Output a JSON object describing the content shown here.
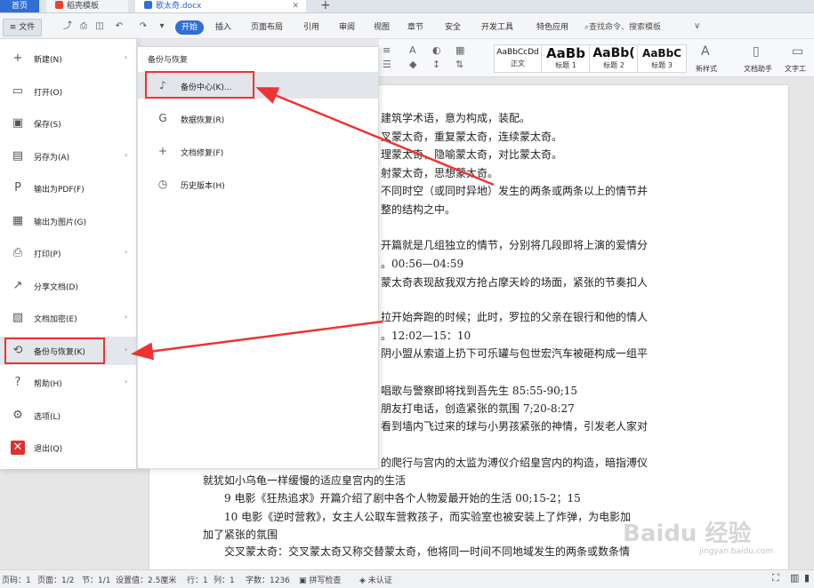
{
  "tabs": {
    "home": "首页",
    "templates": "稻壳模板",
    "doc": "歌太奇.docx",
    "add": "+"
  },
  "ribbon": {
    "file": "≡ 文件",
    "tabs": [
      "开始",
      "插入",
      "页面布局",
      "引用",
      "审阅",
      "视图",
      "章节",
      "安全",
      "开发工具",
      "特色应用"
    ],
    "search": "查找命令、搜索模板"
  },
  "styles": [
    {
      "sample": "AaBbCcDd",
      "name": "正文"
    },
    {
      "sample": "AaBb",
      "name": "标题 1"
    },
    {
      "sample": "AaBb(",
      "name": "标题 2"
    },
    {
      "sample": "AaBbC",
      "name": "标题 3"
    }
  ],
  "toolbar_right": {
    "new_style": "新样式",
    "doc_helper": "文档助手",
    "text_tools": "文字工"
  },
  "file_menu": [
    {
      "label": "新建(N)",
      "icon": "new-doc-icon",
      "glyph": "+",
      "arrow": true
    },
    {
      "label": "打开(O)",
      "icon": "folder-icon",
      "glyph": "▭",
      "arrow": false
    },
    {
      "label": "保存(S)",
      "icon": "save-icon",
      "glyph": "▣",
      "arrow": false
    },
    {
      "label": "另存为(A)",
      "icon": "save-as-icon",
      "glyph": "▤",
      "arrow": true
    },
    {
      "label": "输出为PDF(F)",
      "icon": "pdf-icon",
      "glyph": "P",
      "arrow": false
    },
    {
      "label": "输出为图片(G)",
      "icon": "image-icon",
      "glyph": "▦",
      "arrow": false
    },
    {
      "label": "打印(P)",
      "icon": "print-icon",
      "glyph": "⎙",
      "arrow": true
    },
    {
      "label": "分享文档(D)",
      "icon": "share-icon",
      "glyph": "↗",
      "arrow": false
    },
    {
      "label": "文档加密(E)",
      "icon": "lock-doc-icon",
      "glyph": "▧",
      "arrow": true
    },
    {
      "label": "备份与恢复(K)",
      "icon": "backup-icon",
      "glyph": "⟲",
      "arrow": true
    },
    {
      "label": "帮助(H)",
      "icon": "help-icon",
      "glyph": "?",
      "arrow": true
    },
    {
      "label": "选项(L)",
      "icon": "gear-icon",
      "glyph": "⚙",
      "arrow": false
    },
    {
      "label": "退出(Q)",
      "icon": "exit-icon",
      "glyph": "✕",
      "arrow": false
    }
  ],
  "sub_menu": {
    "title": "备份与恢复",
    "items": [
      {
        "label": "备份中心(K)...",
        "icon": "backup-center-icon",
        "glyph": "♪"
      },
      {
        "label": "数据恢复(R)",
        "icon": "data-restore-icon",
        "glyph": "G"
      },
      {
        "label": "文档修复(F)",
        "icon": "doc-repair-icon",
        "glyph": "+"
      },
      {
        "label": "历史版本(H)",
        "icon": "history-icon",
        "glyph": "◷"
      }
    ]
  },
  "doc_lines": [
    "建筑学术语，意为构成，装配。",
    "叉蒙太奇，重复蒙太奇，连续蒙太奇。",
    "理蒙太奇，隐喻蒙太奇，对比蒙太奇。",
    "射蒙太奇，思想蒙太奇。",
    "不同时空（或同时异地）发生的两条或两条以上的情节并",
    "整的结构之中。",
    "开篇就是几组独立的情节，分别将几段即将上演的爱情分",
    "。00:56—04:59",
    "蒙太奇表现敌我双方抢占摩天岭的场面，紧张的节奏扣人",
    "拉开始奔跑的时候；此时，罗拉的父亲在银行和他的情人",
    "。12:02—15：10",
    "阴小盟从索道上扔下可乐罐与包世宏汽车被砸构成一组平",
    "唱歌与警察即将找到吾先生 85:55-90;15",
    "朋友打电话，创造紧张的氛围 7;20-8:27",
    "看到墙内飞过来的球与小男孩紧张的神情，引发老人家对",
    "的爬行与宫内的太监为溥仪介绍皇宫内的构造，暗指溥仪",
    "就犹如小乌龟一样缓慢的适应皇宫内的生活",
    "9 电影《狂热追求》开篇介绍了剧中各个人物爱最开始的生活 00;15-2；15",
    "10 电影《逆时营救》，女主人公取车营救孩子，而实验室也被安装上了炸弹，为电影加",
    "加了紧张的氛围",
    "交叉蒙太奇：交叉蒙太奇又称交替蒙太奇，他将同一时间不同地域发生的两条或数条情"
  ],
  "status": {
    "page": "页码：1",
    "pages": "页面：1/2",
    "section": "节：1/1",
    "setting": "设置值：2.5厘米",
    "row": "行：1",
    "col": "列：1",
    "words": "字数：1236",
    "spell": "拼写检查",
    "cert": "未认证"
  },
  "watermark": {
    "text": "Baidu 经验",
    "sub": "jingyan.baidu.com"
  },
  "colors": {
    "accent": "#2f6fd6",
    "highlight_red": "#e33333"
  }
}
